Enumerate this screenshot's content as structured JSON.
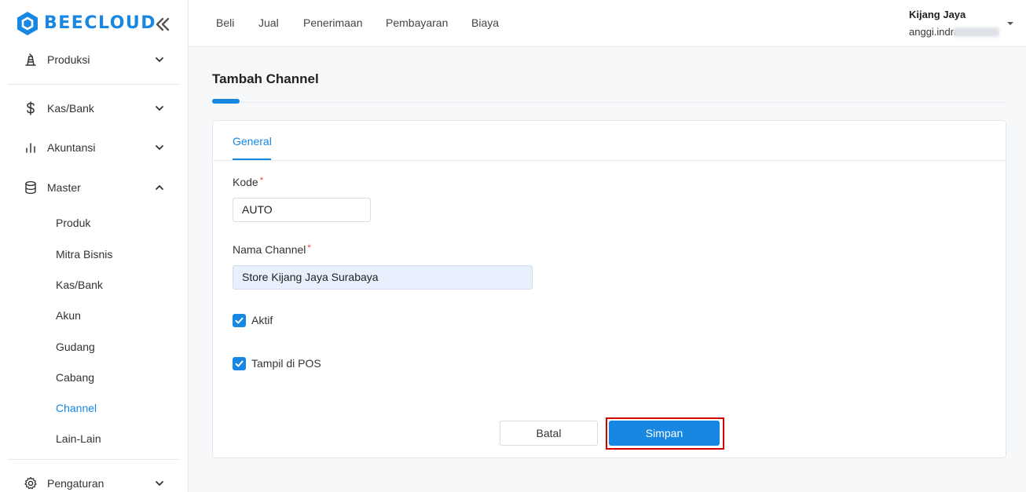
{
  "brand": {
    "name": "BEECLOUD",
    "color": "#1787e2"
  },
  "sidebar": {
    "menu": [
      {
        "key": "produksi",
        "label": "Produksi",
        "icon": "production-icon",
        "expanded": false
      },
      {
        "key": "kasbank",
        "label": "Kas/Bank",
        "icon": "dollar-icon",
        "expanded": false
      },
      {
        "key": "akuntansi",
        "label": "Akuntansi",
        "icon": "bar-chart-icon",
        "expanded": false
      },
      {
        "key": "master",
        "label": "Master",
        "icon": "database-icon",
        "expanded": true
      },
      {
        "key": "pengaturan",
        "label": "Pengaturan",
        "icon": "gear-icon",
        "expanded": false
      }
    ],
    "master_items": [
      "Produk",
      "Mitra Bisnis",
      "Kas/Bank",
      "Akun",
      "Gudang",
      "Cabang",
      "Channel",
      "Lain-Lain"
    ],
    "active_item": "Channel"
  },
  "topnav": [
    "Beli",
    "Jual",
    "Penerimaan",
    "Pembayaran",
    "Biaya"
  ],
  "user": {
    "company": "Kijang Jaya",
    "email_visible": "anggi.indra"
  },
  "page": {
    "title": "Tambah Channel"
  },
  "form": {
    "tab": "General",
    "kode": {
      "label": "Kode",
      "required_mark": "*",
      "value": "AUTO"
    },
    "nama": {
      "label": "Nama Channel",
      "required_mark": "*",
      "value": "Store Kijang Jaya Surabaya"
    },
    "aktif": {
      "label": "Aktif",
      "checked": true
    },
    "tampil_pos": {
      "label": "Tampil di POS",
      "checked": true
    },
    "cancel_label": "Batal",
    "save_label": "Simpan"
  }
}
